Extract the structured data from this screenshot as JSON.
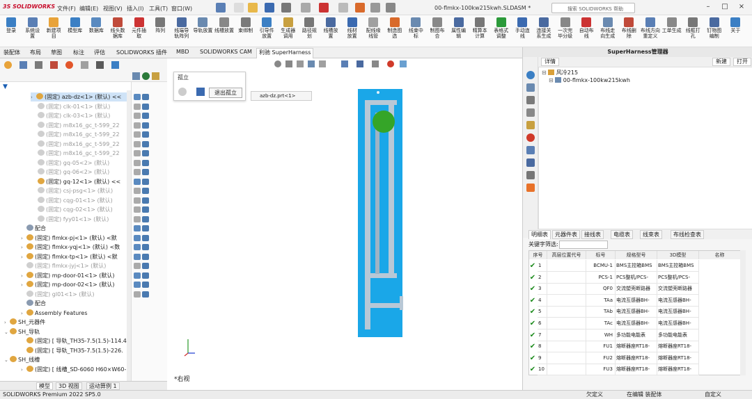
{
  "app": {
    "logo": "3S SOLIDWORKS",
    "doc_title": "00-flmkx-100kw215kwh.SLDASM *",
    "search_placeholder": "搜索 SOLIDWORKS 帮助"
  },
  "menus": [
    "文件(F)",
    "编辑(E)",
    "视图(V)",
    "插入(I)",
    "工具(T)",
    "窗口(W)"
  ],
  "ribbon": [
    "登录",
    "系统设\n置",
    "新建项\n目",
    "模型库",
    "数据库",
    "线头数\n据库",
    "元件插\n取",
    "阵列",
    "线端导\n轨阵列",
    "导轨放置",
    "线槽放置",
    "束绑制",
    "引导件\n放置",
    "生成器\n调用",
    "路径规\n划",
    "线槽放\n置",
    "线材\n放置",
    "配线缘\n线管",
    "制造图\n选",
    "线束中\n标",
    "制图布\n合",
    "属性编\n辑",
    "精算本\n计算",
    "表格式\n调整",
    "手动连\n线",
    "连接关\n系生成",
    "一次完\n毕分级",
    "自动布\n线",
    "布线走\n向生成",
    "布线删\n除",
    "布线方向\n重定义",
    "工单生成",
    "线框打\n孔",
    "钉物图\n编制",
    "关于"
  ],
  "cmdtabs": [
    "装配体",
    "布局",
    "草图",
    "标注",
    "评估",
    "SOLIDWORKS 插件",
    "MBD",
    "SOLIDWORKS CAM",
    "利驰 SuperHarness"
  ],
  "tree": [
    {
      "t": "(固定) azb-dz<1> (默认) <<",
      "g": false,
      "sel": true
    },
    {
      "t": "(固定) clk-01<1> (默认)",
      "g": true
    },
    {
      "t": "(固定) clk-03<1> (默认)",
      "g": true
    },
    {
      "t": "(固定) m8x16_gc_t-599_22",
      "g": true
    },
    {
      "t": "(固定) m8x16_gc_t-599_22",
      "g": true
    },
    {
      "t": "(固定) m8x16_gc_t-599_22",
      "g": true
    },
    {
      "t": "(固定) m8x16_gc_t-599_22",
      "g": true
    },
    {
      "t": "(固定) gq-05<2> (默认)",
      "g": true
    },
    {
      "t": "(固定) gq-06<2> (默认)",
      "g": true
    },
    {
      "t": "(固定) gq-12<1> (默认) <<",
      "g": false
    },
    {
      "t": "(固定) csj-psg<1> (默认)",
      "g": true
    },
    {
      "t": "(固定) cqg-01<1> (默认)",
      "g": true
    },
    {
      "t": "(固定) cqg-02<1> (默认)",
      "g": true
    },
    {
      "t": "(固定) fyy01<1> (默认)",
      "g": true
    },
    {
      "t": "配合",
      "g": false
    },
    {
      "t": "(固定) flmkx-pj<1> (默认) <默",
      "g": false
    },
    {
      "t": "(固定) flmkx-yqj<1> (默认) <数",
      "g": false
    },
    {
      "t": "(固定) flmkx-tp<1> (默认) <默",
      "g": false
    },
    {
      "t": "(固定) flmkx-jyj<1> (默认)",
      "g": true
    },
    {
      "t": "(固定) mp-door-01<1> (默认)",
      "g": false
    },
    {
      "t": "(固定) mp-door-02<1> (默认)",
      "g": false
    },
    {
      "t": "(固定) gl01<1> (默认)",
      "g": true
    },
    {
      "t": "配合",
      "g": false
    },
    {
      "t": "Assembly Features",
      "g": false
    },
    {
      "t": "SH_元器件",
      "g": false
    },
    {
      "t": "SH_导轨",
      "g": false
    },
    {
      "t": "(固定) [ 导轨_TH35-7.5(1.5)-114.4",
      "g": false
    },
    {
      "t": "(固定) [ 导轨_TH35-7.5(1.5)-226.",
      "g": false
    },
    {
      "t": "SH_线槽",
      "g": false
    },
    {
      "t": "(固定) [ 线槽_SD-6060 H60×W60-",
      "g": false
    }
  ],
  "isolate": {
    "title": "孤立",
    "exit": "退出孤立"
  },
  "subtab": "azb-dz.prt<1>",
  "view_name": "*右视",
  "rpanel": {
    "title": "SuperHarness管理器",
    "new_btn": "新建",
    "open_btn": "打开",
    "detail_tab": "详情",
    "project": "风冷215",
    "asm": "00-flmkx-100kw215kwh",
    "tabs": [
      "明细表",
      "元器件表",
      "接线表",
      "电缆表",
      "线束表",
      "布线检查表"
    ],
    "filter_label": "关键字筛选:",
    "headers": [
      "序号",
      "高层位置代号",
      "标号",
      "规格型号",
      "3D模型",
      "名称"
    ],
    "rows": [
      [
        "1",
        "",
        "BCMU-1",
        "BMS主控箱BMS",
        "BMS主控箱BMS"
      ],
      [
        "2",
        "",
        "PCS-1",
        "PCS整机/PCS-",
        "PCS整机/PCS-"
      ],
      [
        "3",
        "",
        "QF0",
        "交流塑壳断路器",
        "交流塑壳断路器"
      ],
      [
        "4",
        "",
        "TAa",
        "电流互感器BH-",
        "电流互感器BH-"
      ],
      [
        "5",
        "",
        "TAb",
        "电流互感器BH-",
        "电流互感器BH-"
      ],
      [
        "6",
        "",
        "TAc",
        "电流互感器BH-",
        "电流互感器BH-"
      ],
      [
        "7",
        "",
        "WH",
        "多功能电能表",
        "多功能电能表"
      ],
      [
        "8",
        "",
        "FU1",
        "熔断器座RT18-",
        "熔断器座RT18-"
      ],
      [
        "9",
        "",
        "FU2",
        "熔断器座RT18-",
        "熔断器座RT18-"
      ],
      [
        "10",
        "",
        "FU3",
        "熔断器座RT18-",
        "熔断器座RT18-"
      ]
    ]
  },
  "bottom_tabs": [
    "模型",
    "3D 视图",
    "运动算例 1"
  ],
  "status": {
    "left": "SOLIDWORKS Premium 2022 SP5.0",
    "s1": "欠定义",
    "s2": "在编辑 装配体",
    "s3": "自定义"
  }
}
